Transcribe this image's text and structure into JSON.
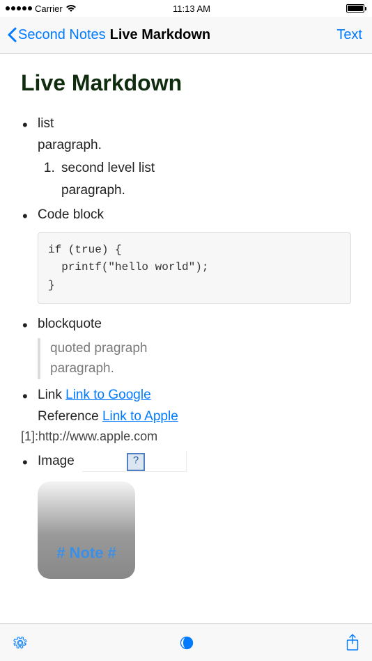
{
  "status": {
    "carrier": "Carrier",
    "time": "11:13 AM"
  },
  "nav": {
    "back_label": "Second Notes",
    "title": "Live Markdown",
    "right_button": "Text"
  },
  "doc": {
    "heading": "Live Markdown",
    "items": {
      "list_label": "list",
      "paragraph_text": "paragraph.",
      "ol_item": "second level list",
      "ol_para": "paragraph.",
      "code_label": "Code block",
      "code_text": "if (true) {\n  printf(\"hello world\");\n}",
      "blockquote_label": "blockquote",
      "bq_line1": "quoted pragraph",
      "bq_line2": "paragraph.",
      "link_label": "Link ",
      "link_text": "Link to Google",
      "ref_label": "Reference ",
      "ref_link_text": "Link to Apple",
      "ref_def": "[1]:http://www.apple.com",
      "image_label": "Image",
      "note_icon_text": "# Note #"
    }
  }
}
